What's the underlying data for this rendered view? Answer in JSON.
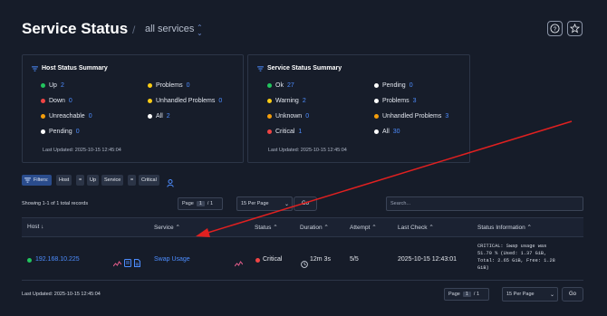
{
  "header": {
    "title": "Service Status",
    "separator": "/",
    "subtitle": "all services",
    "subtitle_caret": "⌃⌄",
    "help_icon": "question-circle-icon",
    "star_icon": "star-icon"
  },
  "host_summary": {
    "title": "Host Status Summary",
    "items": [
      {
        "label": "Up",
        "value": "2",
        "color": "#22c55e"
      },
      {
        "label": "Down",
        "value": "0",
        "color": "#ef4444"
      },
      {
        "label": "Unreachable",
        "value": "0",
        "color": "#f59e0b"
      },
      {
        "label": "Pending",
        "value": "0",
        "color": "#ffffff"
      }
    ],
    "items_right": [
      {
        "label": "Problems",
        "value": "0",
        "color": "#facc15"
      },
      {
        "label": "Unhandled Problems",
        "value": "0",
        "color": "#facc15"
      },
      {
        "label": "All",
        "value": "2",
        "color": "#ffffff"
      }
    ],
    "updated": "Last Updated: 2025-10-15 12:45:04"
  },
  "service_summary": {
    "title": "Service Status Summary",
    "items": [
      {
        "label": "Ok",
        "value": "27",
        "color": "#22c55e"
      },
      {
        "label": "Warning",
        "value": "2",
        "color": "#facc15"
      },
      {
        "label": "Unknown",
        "value": "0",
        "color": "#f59e0b"
      },
      {
        "label": "Critical",
        "value": "1",
        "color": "#ef4444"
      }
    ],
    "items_right": [
      {
        "label": "Pending",
        "value": "0",
        "color": "#ffffff"
      },
      {
        "label": "Problems",
        "value": "3",
        "color": "#ffffff"
      },
      {
        "label": "Unhandled Problems",
        "value": "3",
        "color": "#f59e0b"
      },
      {
        "label": "All",
        "value": "30",
        "color": "#ffffff"
      }
    ],
    "updated": "Last Updated: 2025-10-15 12:45:04"
  },
  "filters": {
    "label": "Filters:",
    "chips": [
      "Host",
      "=",
      "Up",
      "Service",
      "=",
      "Critical"
    ]
  },
  "pager_top": {
    "showing": "Showing 1-1 of 1 total records",
    "page_label": "Page",
    "page_value": "1",
    "of_label": "/ 1",
    "per_page": "15 Per Page",
    "go": "Go",
    "search_placeholder": "Search..."
  },
  "table": {
    "columns": [
      "Host ↓",
      "Service ⌃",
      "Status ⌃",
      "Duration ⌃",
      "Attempt ⌃",
      "Last Check ⌃",
      "Status Information ⌃"
    ],
    "row": {
      "host": "192.168.10.225",
      "service": "Swap Usage",
      "status": "Critical",
      "duration": "12m 3s",
      "attempt": "5/5",
      "last_check": "2025-10-15 12:43:01",
      "info": [
        "CRITICAL: Swap usage was",
        "51.70 % (Used: 1.37 GiB,",
        "Total: 2.65 GiB, Free: 1.28",
        "GiB)"
      ]
    }
  },
  "footer": {
    "updated": "Last Updated: 2025-10-15 12:45:04",
    "page_label": "Page",
    "page_value": "1",
    "of_label": "/ 1",
    "per_page": "15 Per Page",
    "go": "Go"
  },
  "colors": {
    "accent": "#4d8dff",
    "background": "#161c29",
    "annotation_arrow": "#e02020"
  }
}
